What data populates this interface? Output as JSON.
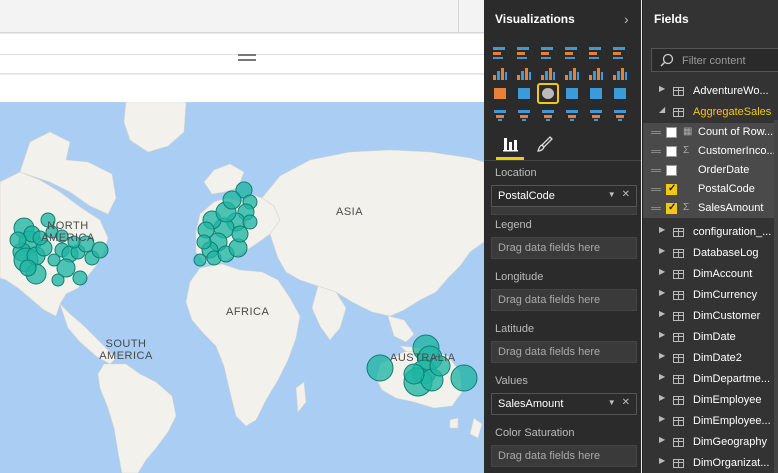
{
  "visualizations": {
    "title": "Visualizations",
    "wells": [
      {
        "label": "Location",
        "value": "PostalCode",
        "placeholder": ""
      },
      {
        "label": "Legend",
        "value": "",
        "placeholder": "Drag data fields here"
      },
      {
        "label": "Longitude",
        "value": "",
        "placeholder": "Drag data fields here"
      },
      {
        "label": "Latitude",
        "value": "",
        "placeholder": "Drag data fields here"
      },
      {
        "label": "Values",
        "value": "SalesAmount",
        "placeholder": ""
      },
      {
        "label": "Color Saturation",
        "value": "",
        "placeholder": "Drag data fields here"
      }
    ]
  },
  "map": {
    "labels": [
      "NORTH AMERICA",
      "ASIA",
      "AFRICA",
      "SOUTH AMERICA",
      "AUSTRALIA"
    ],
    "bubble_color": "#1fb5a3"
  },
  "fields": {
    "title": "Fields",
    "filter_placeholder": "Filter content",
    "tables": [
      {
        "name": "AdventureWo...",
        "expanded": false
      },
      {
        "name": "AggregateSales",
        "expanded": true,
        "highlight": "#f2c811",
        "columns": [
          {
            "name": "Count of Row...",
            "type": "calc",
            "checked": false
          },
          {
            "name": "CustomerInco...",
            "type": "sigma",
            "checked": false
          },
          {
            "name": "OrderDate",
            "type": "",
            "checked": false
          },
          {
            "name": "PostalCode",
            "type": "",
            "checked": true
          },
          {
            "name": "SalesAmount",
            "type": "sigma",
            "checked": true
          }
        ]
      },
      {
        "name": "configuration_...",
        "expanded": false
      },
      {
        "name": "DatabaseLog",
        "expanded": false
      },
      {
        "name": "DimAccount",
        "expanded": false
      },
      {
        "name": "DimCurrency",
        "expanded": false
      },
      {
        "name": "DimCustomer",
        "expanded": false
      },
      {
        "name": "DimDate",
        "expanded": false
      },
      {
        "name": "DimDate2",
        "expanded": false
      },
      {
        "name": "DimDepartme...",
        "expanded": false
      },
      {
        "name": "DimEmployee",
        "expanded": false
      },
      {
        "name": "DimEmployee...",
        "expanded": false
      },
      {
        "name": "DimGeography",
        "expanded": false
      },
      {
        "name": "DimOrganizat...",
        "expanded": false
      }
    ]
  }
}
